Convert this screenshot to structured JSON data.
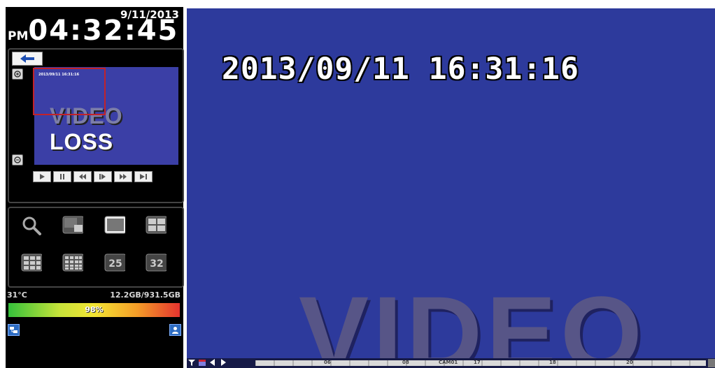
{
  "clock": {
    "date": "9/11/2013",
    "ampm": "PM",
    "time": "04:32:45"
  },
  "preview": {
    "timestamp": "2013/09/11 16:31:16",
    "loss_dim": "VIDEO",
    "loss_bright": " LOSS",
    "playback_buttons": [
      "play",
      "pause",
      "rewind",
      "step",
      "fast-forward",
      "next"
    ]
  },
  "view_buttons": [
    "search",
    "pip",
    "single",
    "quad",
    "9-split",
    "16-split",
    "25",
    "32"
  ],
  "status": {
    "temperature": "31°C",
    "hdd": "12.2GB/931.5GB",
    "hdd_usage_pct": "98%"
  },
  "main": {
    "osd_timestamp": "2013/09/11  16:31:16",
    "background_text": "VIDEO",
    "timeline_labels": [
      "06",
      "08",
      "CAM01",
      "17",
      "18",
      "20"
    ]
  },
  "colors": {
    "video_bg": "#2d3a9c",
    "roi": "#c2222a"
  }
}
